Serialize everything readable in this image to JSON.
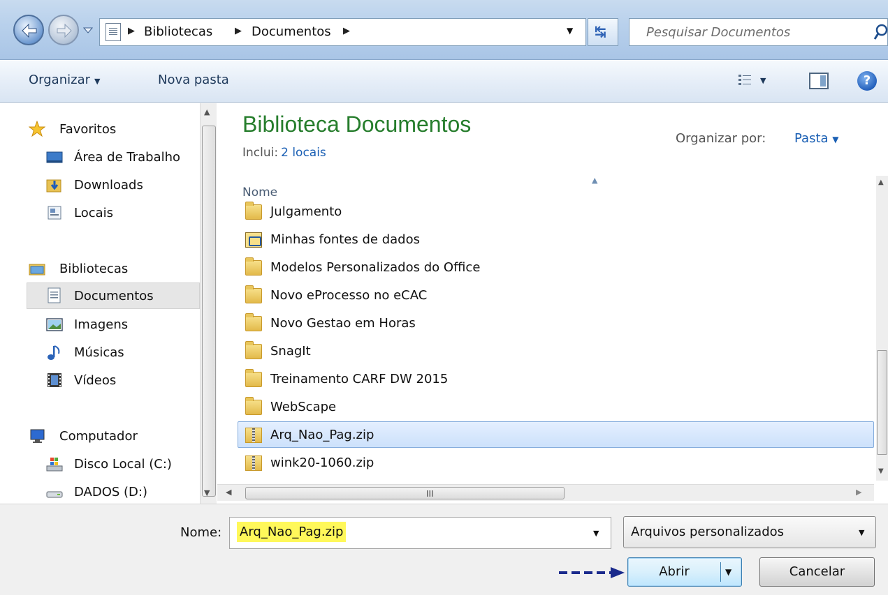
{
  "address": {
    "breadcrumb": [
      "Bibliotecas",
      "Documentos"
    ],
    "search_placeholder": "Pesquisar Documentos"
  },
  "toolbar": {
    "organize_label": "Organizar",
    "new_folder_label": "Nova pasta"
  },
  "nav": {
    "favorites_label": "Favoritos",
    "desktop_label": "Área de Trabalho",
    "downloads_label": "Downloads",
    "places_label": "Locais",
    "libraries_label": "Bibliotecas",
    "documents_label": "Documentos",
    "pictures_label": "Imagens",
    "music_label": "Músicas",
    "videos_label": "Vídeos",
    "computer_label": "Computador",
    "local_disk_label": "Disco Local (C:)",
    "data_disk_label": "DADOS (D:)"
  },
  "library": {
    "title": "Biblioteca Documentos",
    "includes_label": "Inclui:",
    "includes_value": "2 locais",
    "arrange_label": "Organizar por:",
    "arrange_value": "Pasta",
    "column_name": "Nome"
  },
  "files": [
    {
      "name": "Julgamento",
      "type": "folder"
    },
    {
      "name": "Minhas fontes de dados",
      "type": "datasource"
    },
    {
      "name": "Modelos Personalizados do Office",
      "type": "folder"
    },
    {
      "name": "Novo eProcesso no eCAC",
      "type": "folder"
    },
    {
      "name": "Novo Gestao em Horas",
      "type": "folder"
    },
    {
      "name": "SnagIt",
      "type": "folder"
    },
    {
      "name": "Treinamento CARF DW 2015",
      "type": "folder"
    },
    {
      "name": "WebScape",
      "type": "folder"
    },
    {
      "name": "Arq_Nao_Pag.zip",
      "type": "zip",
      "selected": true
    },
    {
      "name": "wink20-1060.zip",
      "type": "zip"
    }
  ],
  "dialog": {
    "filename_label": "Nome:",
    "filename_value": "Arq_Nao_Pag.zip",
    "filetype_value": "Arquivos personalizados",
    "open_label": "Abrir",
    "cancel_label": "Cancelar"
  },
  "colors": {
    "title_green": "#267d2c",
    "link_blue": "#1a5fb4",
    "highlight_yellow": "#fff85a",
    "selection_border": "#84acdd"
  }
}
